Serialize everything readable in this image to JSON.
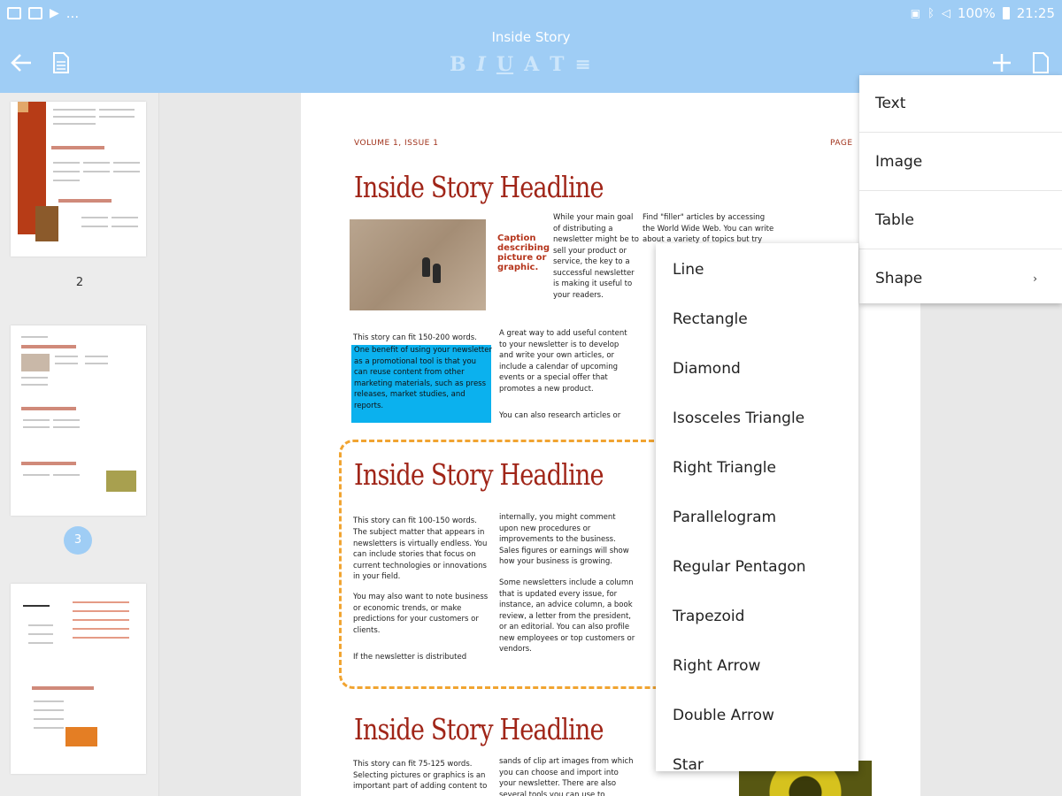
{
  "statusbar": {
    "battery": "100%",
    "time": "21:25",
    "dots": "..."
  },
  "toolbar": {
    "title": "Inside Story",
    "format": [
      "B",
      "I",
      "U",
      "A",
      "T",
      "≡"
    ]
  },
  "thumbs": {
    "page2_label": "2",
    "page3_label": "3"
  },
  "page": {
    "volume": "VOLUME 1, ISSUE 1",
    "page_label": "PAGE",
    "headline1": "Inside Story Headline",
    "caption": "Caption describing picture or graphic.",
    "col_mid1": "While your main goal of distributing a newsletter might be to sell your product or service, the key to a successful newsletter is making it useful to your readers.",
    "col_right1": "Find \"filler\" articles by accessing the World Wide Web. You can write about a variety of topics but try",
    "col_left1": "This story can fit 150-200 words.",
    "highlight_text": "One benefit of using your newsletter as a promotional tool is that you can reuse content from other marketing materials, such as press releases, market studies, and reports.",
    "col_mid2": "A great way to add useful content to your newsletter is to develop and write your own articles, or include a calendar of upcoming events or a special offer that promotes a new product.",
    "col_mid3": "You can also research articles or",
    "headline2": "Inside Story Headline",
    "col_left2a": "This story can fit 100-150 words.",
    "col_left2b": "The subject matter that appears in newsletters is virtually endless. You can include stories that focus on current technologies or innovations in your field.",
    "col_left2c": "You may also want to note business or economic trends, or make predictions for your customers or clients.",
    "col_left2d": "If the newsletter is distributed",
    "col_mid4": "internally, you might comment upon new procedures or improvements to the business. Sales figures or earnings will show how your business is growing.",
    "col_mid5": "Some newsletters include a column that is updated every issue, for instance, an advice column, a book review, a letter from the president, or an editorial. You can also profile new employees or top customers or vendors.",
    "headline3": "Inside Story Headline",
    "col_left3": "This story can fit 75-125 words. Selecting pictures or graphics is an important part of adding content to",
    "col_mid6": "sands of clip art images from which you can choose and import into your newsletter. There are also several tools you can use to"
  },
  "insert_menu": {
    "items": [
      "Text",
      "Image",
      "Table",
      "Shape"
    ],
    "submenu_arrow": "›"
  },
  "shape_menu": {
    "items": [
      "Line",
      "Rectangle",
      "Diamond",
      "Isosceles Triangle",
      "Right Triangle",
      "Parallelogram",
      "Regular Pentagon",
      "Trapezoid",
      "Right Arrow",
      "Double Arrow",
      "Star"
    ]
  },
  "colors": {
    "accent": "#9fcdf5",
    "headline": "#a02518",
    "highlight": "#0bb1ee",
    "dash": "#f1a431"
  }
}
